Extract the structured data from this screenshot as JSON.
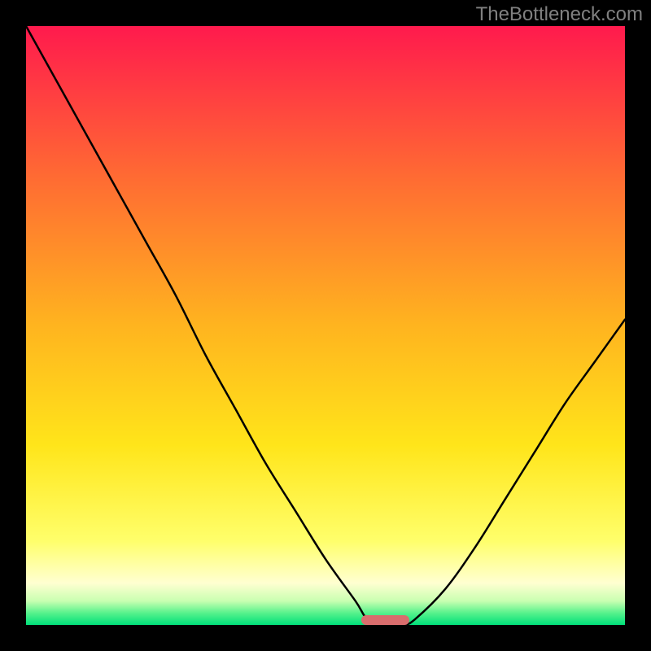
{
  "watermark": "TheBottleneck.com",
  "colors": {
    "marker": "#d96d6d",
    "curve": "#000000",
    "background_top": "#ff1a4d",
    "background_bottom": "#00e07a",
    "frame": "#000000"
  },
  "chart_data": {
    "type": "line",
    "title": "",
    "xlabel": "",
    "ylabel": "",
    "xlim": [
      0,
      100
    ],
    "ylim": [
      0,
      100
    ],
    "grid": false,
    "legend": false,
    "x": [
      0,
      5,
      10,
      15,
      20,
      25,
      30,
      35,
      40,
      45,
      50,
      55,
      57,
      60,
      63,
      65,
      70,
      75,
      80,
      85,
      90,
      95,
      100
    ],
    "values": [
      100,
      91,
      82,
      73,
      64,
      55,
      45,
      36,
      27,
      19,
      11,
      4,
      1,
      0,
      0,
      1,
      6,
      13,
      21,
      29,
      37,
      44,
      51
    ],
    "minimum_x": 60,
    "marker": {
      "x_center": 60,
      "x_halfwidth": 4,
      "y": 0,
      "height": 1.6
    }
  }
}
